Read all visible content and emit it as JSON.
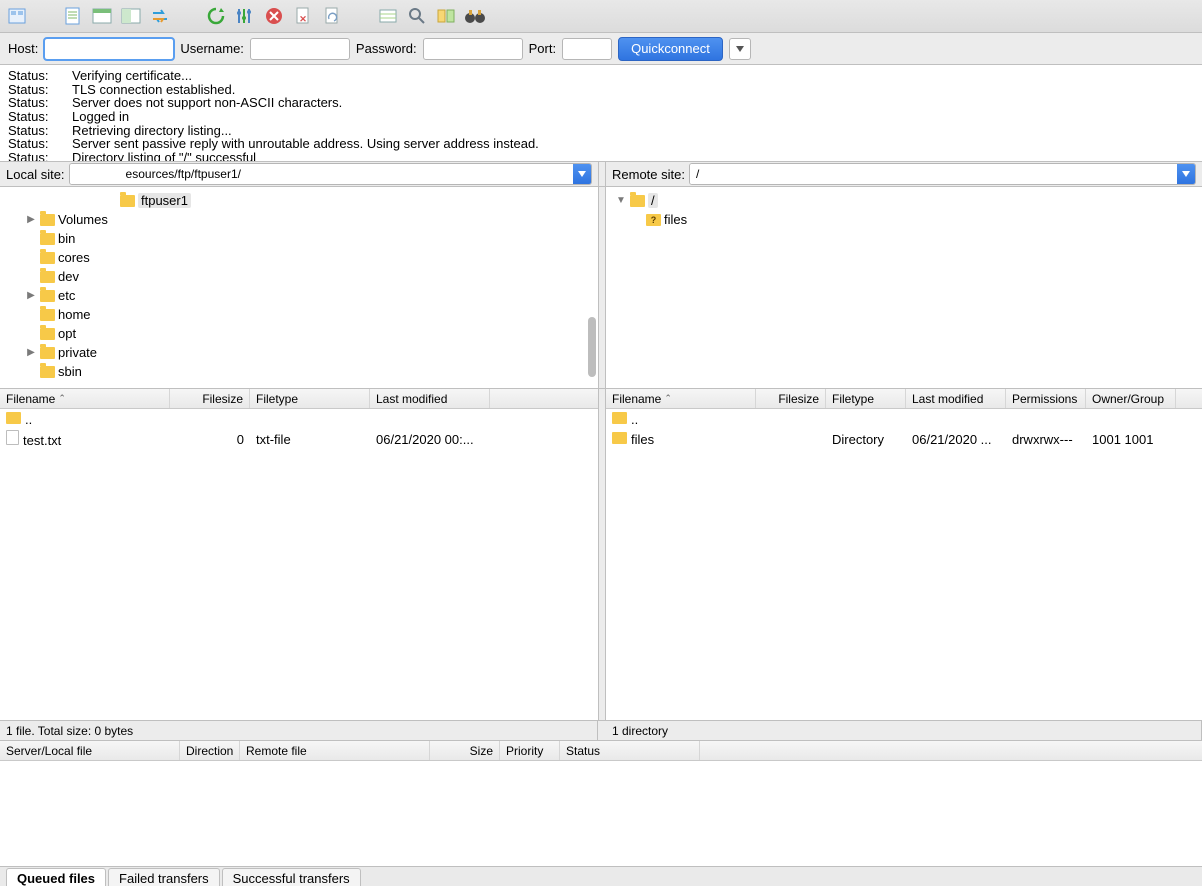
{
  "toolbar_icons": [
    "site-manager",
    "new-tab",
    "toggle-panel-1",
    "toggle-panel-2",
    "sync",
    "refresh",
    "filter",
    "cancel",
    "delete-file",
    "reconnect",
    "list-view",
    "search",
    "compare",
    "binoculars"
  ],
  "quickconnect": {
    "host_label": "Host:",
    "username_label": "Username:",
    "password_label": "Password:",
    "port_label": "Port:",
    "button": "Quickconnect",
    "host": "",
    "username": "",
    "password": "",
    "port": ""
  },
  "log": [
    {
      "label": "Status:",
      "msg": "Verifying certificate..."
    },
    {
      "label": "Status:",
      "msg": "TLS connection established."
    },
    {
      "label": "Status:",
      "msg": "Server does not support non-ASCII characters."
    },
    {
      "label": "Status:",
      "msg": "Logged in"
    },
    {
      "label": "Status:",
      "msg": "Retrieving directory listing..."
    },
    {
      "label": "Status:",
      "msg": "Server sent passive reply with unroutable address. Using server address instead."
    },
    {
      "label": "Status:",
      "msg": "Directory listing of \"/\" successful"
    }
  ],
  "local": {
    "label": "Local site:",
    "path": "               esources/ftp/ftpuser1/",
    "tree": [
      {
        "indent": 6,
        "disclosure": "",
        "name": "ftpuser1",
        "selected": true
      },
      {
        "indent": 1,
        "disclosure": "▶",
        "name": "Volumes"
      },
      {
        "indent": 1,
        "disclosure": "",
        "name": "bin"
      },
      {
        "indent": 1,
        "disclosure": "",
        "name": "cores"
      },
      {
        "indent": 1,
        "disclosure": "",
        "name": "dev"
      },
      {
        "indent": 1,
        "disclosure": "▶",
        "name": "etc"
      },
      {
        "indent": 1,
        "disclosure": "",
        "name": "home"
      },
      {
        "indent": 1,
        "disclosure": "",
        "name": "opt"
      },
      {
        "indent": 1,
        "disclosure": "▶",
        "name": "private"
      },
      {
        "indent": 1,
        "disclosure": "",
        "name": "sbin"
      }
    ],
    "cols": {
      "filename": "Filename",
      "filesize": "Filesize",
      "filetype": "Filetype",
      "modified": "Last modified"
    },
    "files": [
      {
        "icon": "folder",
        "name": "..",
        "size": "",
        "type": "",
        "modified": ""
      },
      {
        "icon": "file",
        "name": "test.txt",
        "size": "0",
        "type": "txt-file",
        "modified": "06/21/2020 00:..."
      }
    ],
    "status": "1 file. Total size: 0 bytes"
  },
  "remote": {
    "label": "Remote site:",
    "path": "/",
    "tree": [
      {
        "indent": 0,
        "disclosure": "▼",
        "name": "/",
        "selected": true,
        "icon": "folder"
      },
      {
        "indent": 1,
        "disclosure": "",
        "name": "files",
        "icon": "folder-q"
      }
    ],
    "cols": {
      "filename": "Filename",
      "filesize": "Filesize",
      "filetype": "Filetype",
      "modified": "Last modified",
      "perms": "Permissions",
      "owner": "Owner/Group"
    },
    "files": [
      {
        "icon": "folder",
        "name": "..",
        "size": "",
        "type": "",
        "modified": "",
        "perms": "",
        "owner": ""
      },
      {
        "icon": "folder",
        "name": "files",
        "size": "",
        "type": "Directory",
        "modified": "06/21/2020 ...",
        "perms": "drwxrwx---",
        "owner": "1001 1001"
      }
    ],
    "status": "1 directory"
  },
  "queue_cols": {
    "server": "Server/Local file",
    "direction": "Direction",
    "remote": "Remote file",
    "size": "Size",
    "priority": "Priority",
    "status": "Status"
  },
  "bottom_tabs": {
    "queued": "Queued files",
    "failed": "Failed transfers",
    "success": "Successful transfers"
  }
}
